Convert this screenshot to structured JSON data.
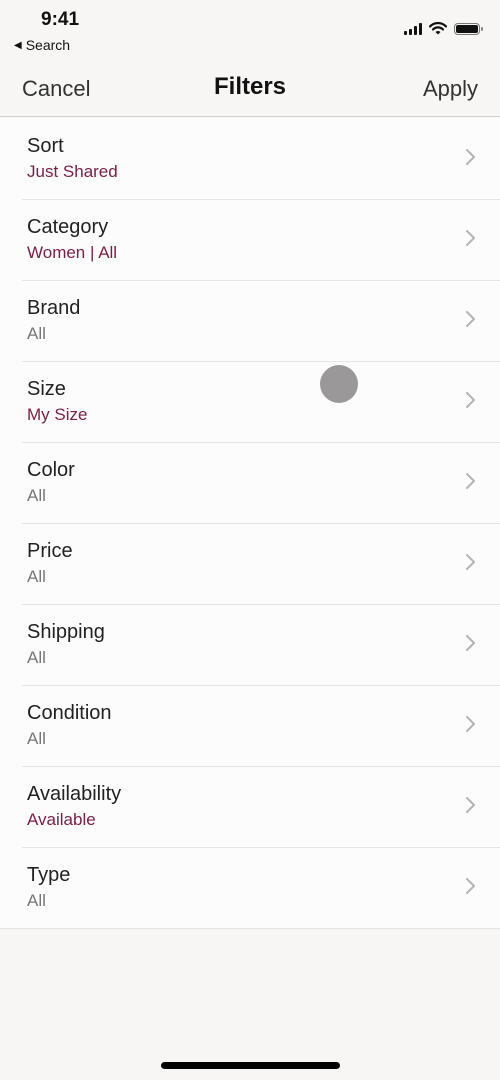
{
  "status_bar": {
    "time": "9:41",
    "back_label": "Search",
    "back_icon": "back-triangle-icon",
    "icons": [
      "signal-icon",
      "wifi-icon",
      "battery-icon"
    ]
  },
  "nav": {
    "cancel_label": "Cancel",
    "title": "Filters",
    "apply_label": "Apply"
  },
  "colors": {
    "accent": "#7a1e45",
    "value_default": "#777777",
    "background": "#f8f6f5"
  },
  "filters": [
    {
      "label": "Sort",
      "value": "Just Shared",
      "highlighted": true
    },
    {
      "label": "Category",
      "value": "Women | All",
      "highlighted": true
    },
    {
      "label": "Brand",
      "value": "All",
      "highlighted": false
    },
    {
      "label": "Size",
      "value": "My Size",
      "highlighted": true
    },
    {
      "label": "Color",
      "value": "All",
      "highlighted": false
    },
    {
      "label": "Price",
      "value": "All",
      "highlighted": false
    },
    {
      "label": "Shipping",
      "value": "All",
      "highlighted": false
    },
    {
      "label": "Condition",
      "value": "All",
      "highlighted": false
    },
    {
      "label": "Availability",
      "value": "Available",
      "highlighted": true
    },
    {
      "label": "Type",
      "value": "All",
      "highlighted": false
    }
  ]
}
